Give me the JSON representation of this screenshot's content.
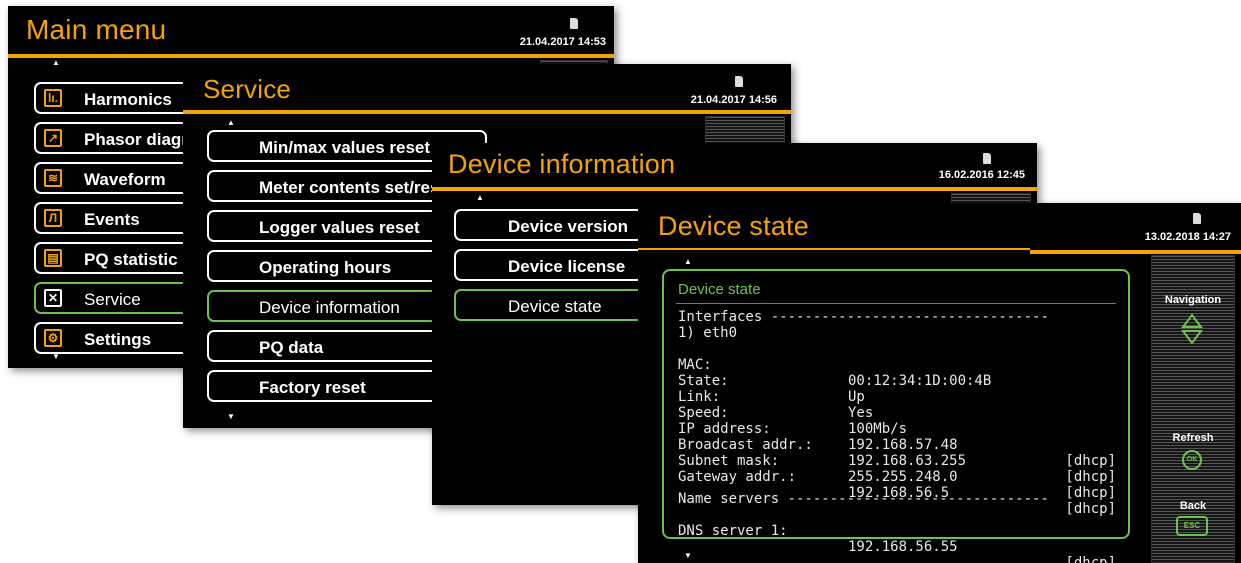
{
  "main_menu": {
    "title": "Main menu",
    "datetime": "21.04.2017  14:53",
    "items": [
      {
        "label": "Harmonics",
        "icon": "harmonics-icon",
        "glyph": "lı."
      },
      {
        "label": "Phasor diagram",
        "icon": "phasor-icon",
        "glyph": "↗"
      },
      {
        "label": "Waveform",
        "icon": "waveform-icon",
        "glyph": "≋"
      },
      {
        "label": "Events",
        "icon": "events-icon",
        "glyph": "Л"
      },
      {
        "label": "PQ statistic",
        "icon": "pq-statistic-icon",
        "glyph": "▤"
      },
      {
        "label": "Service",
        "icon": "service-icon",
        "glyph": "✕"
      },
      {
        "label": "Settings",
        "icon": "settings-icon",
        "glyph": "⚙"
      }
    ],
    "selected": "Service"
  },
  "service": {
    "title": "Service",
    "datetime": "21.04.2017  14:56",
    "items": [
      "Min/max values reset",
      "Meter contents set/reset",
      "Logger values reset",
      "Operating hours",
      "Device information",
      "PQ data",
      "Factory reset"
    ],
    "selected": "Device information"
  },
  "device_information": {
    "title": "Device information",
    "datetime": "16.02.2016  12:45",
    "items": [
      "Device version",
      "Device license",
      "Device state"
    ],
    "selected": "Device state"
  },
  "device_state": {
    "title": "Device state",
    "datetime": "13.02.2018  14:27",
    "panel_title": "Device state",
    "interfaces_header": "Interfaces ---------------------------------",
    "iface_name": "1) eth0",
    "rows": [
      {
        "label": "MAC:",
        "value": "00:12:34:1D:00:4B",
        "tag": ""
      },
      {
        "label": "State:",
        "value": "Up",
        "tag": ""
      },
      {
        "label": "Link:",
        "value": "Yes",
        "tag": ""
      },
      {
        "label": "Speed:",
        "value": "100Mb/s",
        "tag": ""
      },
      {
        "label": "IP address:",
        "value": "192.168.57.48",
        "tag": "[dhcp]"
      },
      {
        "label": "Broadcast addr.:",
        "value": "192.168.63.255",
        "tag": "[dhcp]"
      },
      {
        "label": "Subnet mask:",
        "value": "255.255.248.0",
        "tag": "[dhcp]"
      },
      {
        "label": "Gateway addr.:",
        "value": "192.168.56.5",
        "tag": "[dhcp]"
      }
    ],
    "name_servers_header": "Name servers -------------------------------",
    "dns_label": "DNS server 1:",
    "dns_value": "192.168.56.55",
    "dns_tag": "[dhcp]",
    "sidebar": {
      "navigation": "Navigation",
      "refresh": "Refresh",
      "refresh_key": "OK",
      "back": "Back",
      "back_key": "ESC"
    }
  },
  "colors": {
    "accent": "#f5a300",
    "selected": "#6cc24a",
    "background": "#000000"
  }
}
